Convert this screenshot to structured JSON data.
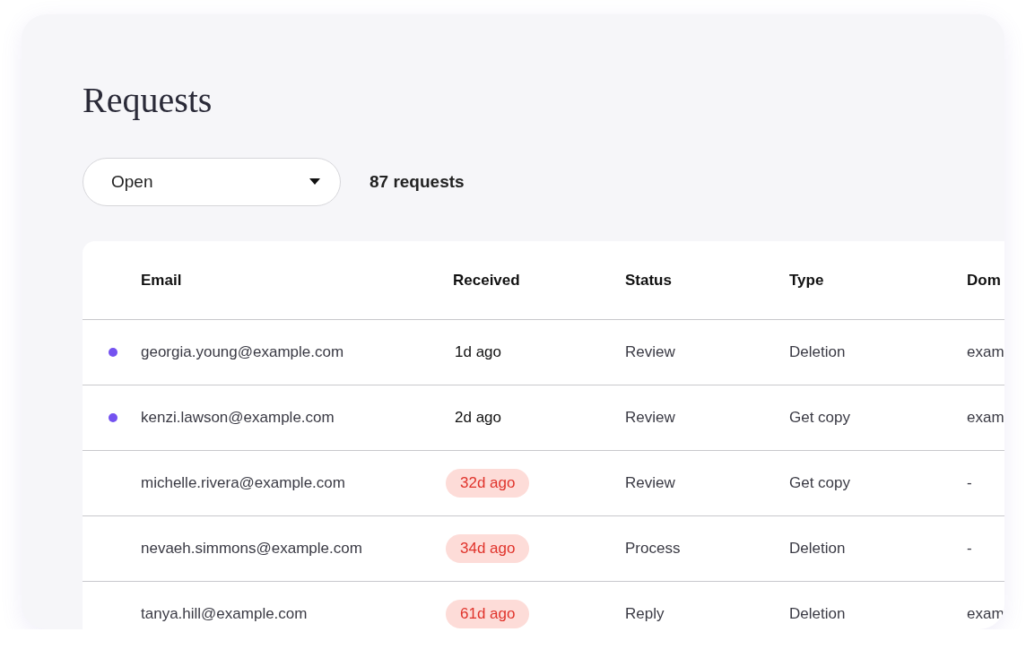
{
  "title": "Requests",
  "filter": {
    "value": "Open"
  },
  "count": "87 requests",
  "table": {
    "columns": [
      "Email",
      "Received",
      "Status",
      "Type",
      "Dom"
    ],
    "rows": [
      {
        "unread": true,
        "email": "georgia.young@example.com",
        "received": "1d ago",
        "overdue": false,
        "status": "Review",
        "type": "Deletion",
        "domain": "exam"
      },
      {
        "unread": true,
        "email": "kenzi.lawson@example.com",
        "received": "2d ago",
        "overdue": false,
        "status": "Review",
        "type": "Get copy",
        "domain": "exam"
      },
      {
        "unread": false,
        "email": "michelle.rivera@example.com",
        "received": "32d ago",
        "overdue": true,
        "status": "Review",
        "type": "Get copy",
        "domain": "-"
      },
      {
        "unread": false,
        "email": "nevaeh.simmons@example.com",
        "received": "34d ago",
        "overdue": true,
        "status": "Process",
        "type": "Deletion",
        "domain": "-"
      },
      {
        "unread": false,
        "email": "tanya.hill@example.com",
        "received": "61d ago",
        "overdue": true,
        "status": "Reply",
        "type": "Deletion",
        "domain": "exam"
      }
    ]
  }
}
